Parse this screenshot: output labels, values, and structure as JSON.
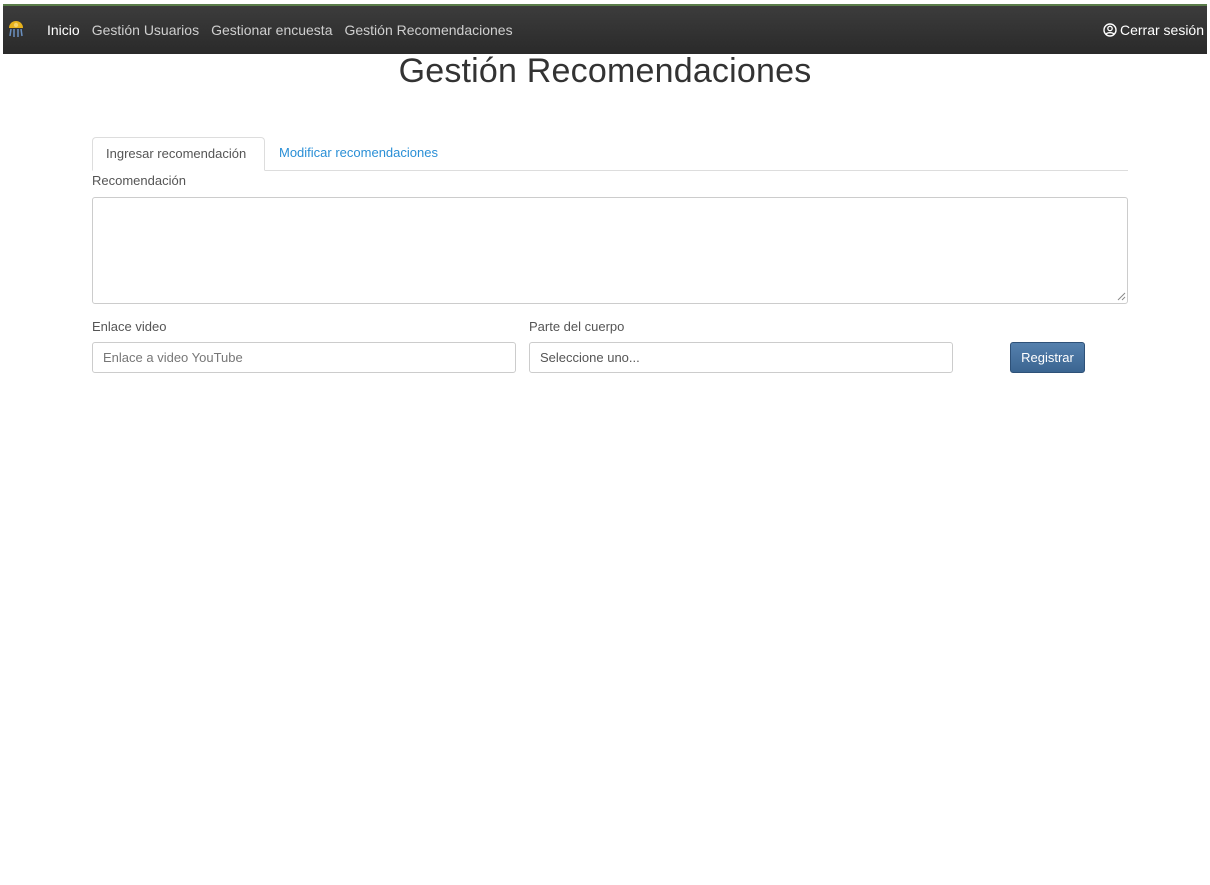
{
  "navbar": {
    "brand_icon": "logo-icon",
    "items": [
      {
        "label": "Inicio",
        "active": true
      },
      {
        "label": "Gestión Usuarios",
        "active": false
      },
      {
        "label": "Gestionar encuesta",
        "active": false
      },
      {
        "label": "Gestión Recomendaciones",
        "active": false
      }
    ],
    "logout": {
      "icon": "user-circle-icon",
      "label": "Cerrar sesión"
    }
  },
  "page": {
    "title": "Gestión Recomendaciones"
  },
  "tabs": [
    {
      "label": "Ingresar recomendación",
      "active": true
    },
    {
      "label": "Modificar recomendaciones",
      "active": false
    }
  ],
  "form": {
    "recommendation": {
      "label": "Recomendación",
      "value": ""
    },
    "video": {
      "label": "Enlace video",
      "placeholder": "Enlace a video YouTube",
      "value": ""
    },
    "body_part": {
      "label": "Parte del cuerpo",
      "selected": "Seleccione uno..."
    },
    "submit_label": "Registrar"
  },
  "colors": {
    "navbar_bg": "#333333",
    "link": "#2a8fd6",
    "primary_button": "#4a729c"
  }
}
